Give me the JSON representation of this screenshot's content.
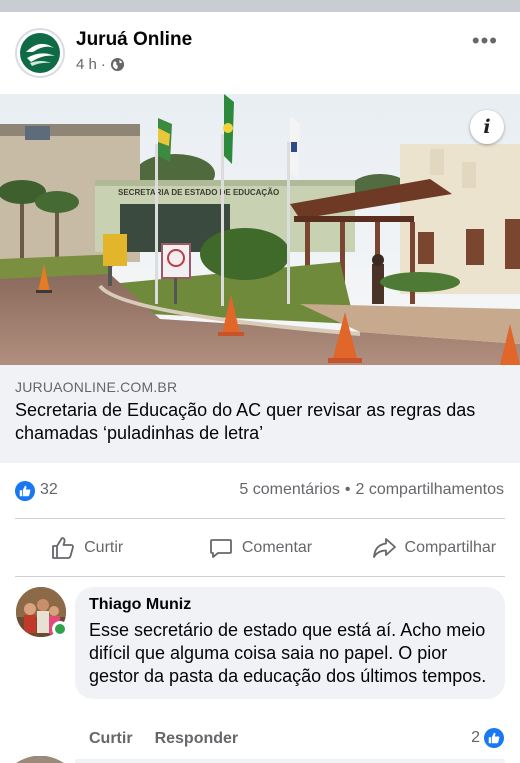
{
  "post": {
    "page_name": "Juruá Online",
    "time": "4 h",
    "separator": "·",
    "more": "•••"
  },
  "link": {
    "domain": "JURUAONLINE.COM.BR",
    "title": "Secretaria de Educação do AC quer revisar as regras das chamadas ‘puladinhas de letra’",
    "image_sign_text": "SECRETARIA DE ESTADO DE EDUCAÇÃO"
  },
  "stats": {
    "reaction_count": "32",
    "comments": "5 comentários",
    "dot": "•",
    "shares": "2 compartilhamentos"
  },
  "actions": {
    "like": "Curtir",
    "comment": "Comentar",
    "share": "Compartilhar"
  },
  "comment": {
    "author": "Thiago Muniz",
    "text": "Esse secretário de estado que está aí. Acho meio difícil que alguma coisa saia no papel. O pior gestor da pasta da educação dos últimos tempos.",
    "like_label": "Curtir",
    "reply_label": "Responder",
    "like_count": "2"
  },
  "colors": {
    "facebook_blue": "#1877f2",
    "secondary_text": "#65676b",
    "bubble_bg": "#f0f2f5",
    "online_green": "#31a24c"
  },
  "icons": [
    "globe-icon",
    "info-icon",
    "like-icon",
    "comment-icon",
    "share-icon",
    "more-icon"
  ]
}
